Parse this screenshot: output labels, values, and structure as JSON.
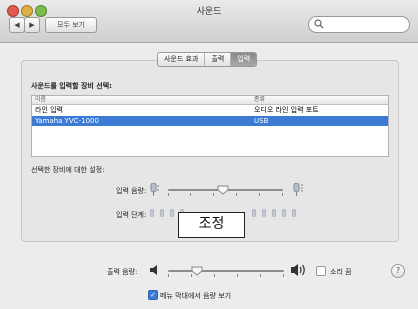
{
  "window": {
    "title": "사운드"
  },
  "toolbar": {
    "back_label": "◀",
    "forward_label": "▶",
    "show_all_label": "모두 보기",
    "search_placeholder": ""
  },
  "tabs": [
    {
      "label": "사운드 효과",
      "selected": false
    },
    {
      "label": "출력",
      "selected": false
    },
    {
      "label": "입력",
      "selected": true
    }
  ],
  "device_select": {
    "heading": "사운드를 입력할 장비 선택:",
    "columns": [
      "이름",
      "종류"
    ],
    "rows": [
      {
        "name": "라인 입력",
        "type": "오디오 라인 입력 포트",
        "selected": false
      },
      {
        "name": "Yamaha YVC-1000",
        "type": "USB",
        "selected": true
      }
    ]
  },
  "settings": {
    "heading": "선택한 장비에 대한 설정:",
    "input_volume_label": "입력 음량:",
    "input_volume_level": 0.48,
    "input_level_label": "입력 단계:"
  },
  "callout": {
    "text": "조정"
  },
  "help": {
    "label": "?"
  },
  "output": {
    "volume_label": "출력 음량:",
    "volume_level": 0.25,
    "mute_label": "소리 끔",
    "mute_checked": false,
    "menu_bar_label": "메뉴 막대에서 음량 보기",
    "menu_bar_checked": true
  },
  "colors": {
    "selection": "#3b7bd4",
    "close": "#e05a4f",
    "minimize": "#dfb144",
    "zoom": "#7abf4c"
  }
}
